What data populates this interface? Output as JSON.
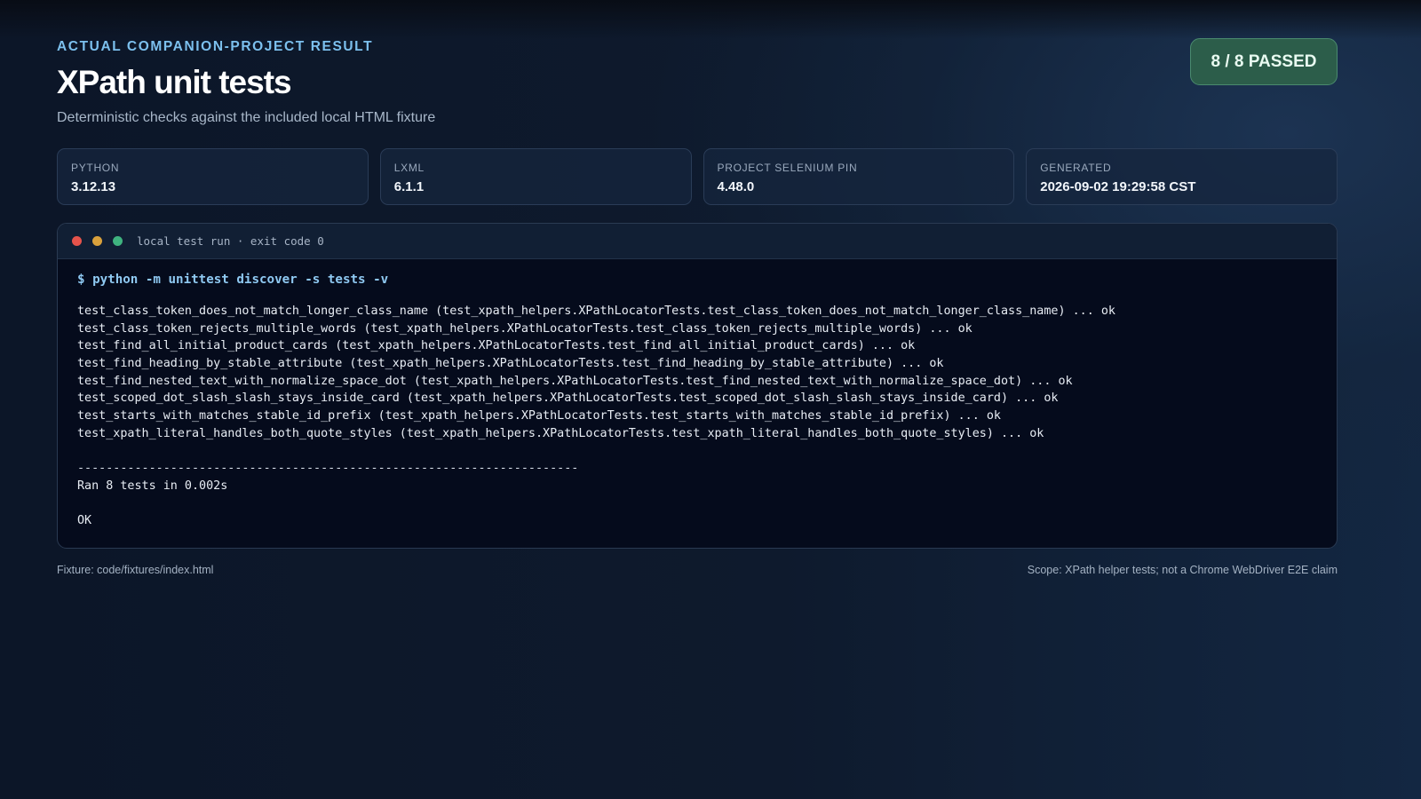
{
  "header": {
    "eyebrow": "ACTUAL COMPANION-PROJECT RESULT",
    "title": "XPath unit tests",
    "subtitle": "Deterministic checks against the included local HTML fixture",
    "status_badge": "8 / 8 PASSED",
    "status_color": "#2c5d4a"
  },
  "info_cards": [
    {
      "label": "PYTHON",
      "value": "3.12.13"
    },
    {
      "label": "LXML",
      "value": "6.1.1"
    },
    {
      "label": "PROJECT SELENIUM PIN",
      "value": "4.48.0"
    },
    {
      "label": "GENERATED",
      "value": "2026-09-02 19:29:58 CST"
    }
  ],
  "terminal": {
    "title": "local test run · exit code 0",
    "command": "$ python -m unittest discover -s tests -v",
    "lines": [
      "test_class_token_does_not_match_longer_class_name (test_xpath_helpers.XPathLocatorTests.test_class_token_does_not_match_longer_class_name) ... ok",
      "test_class_token_rejects_multiple_words (test_xpath_helpers.XPathLocatorTests.test_class_token_rejects_multiple_words) ... ok",
      "test_find_all_initial_product_cards (test_xpath_helpers.XPathLocatorTests.test_find_all_initial_product_cards) ... ok",
      "test_find_heading_by_stable_attribute (test_xpath_helpers.XPathLocatorTests.test_find_heading_by_stable_attribute) ... ok",
      "test_find_nested_text_with_normalize_space_dot (test_xpath_helpers.XPathLocatorTests.test_find_nested_text_with_normalize_space_dot) ... ok",
      "test_scoped_dot_slash_slash_stays_inside_card (test_xpath_helpers.XPathLocatorTests.test_scoped_dot_slash_slash_stays_inside_card) ... ok",
      "test_starts_with_matches_stable_id_prefix (test_xpath_helpers.XPathLocatorTests.test_starts_with_matches_stable_id_prefix) ... ok",
      "test_xpath_literal_handles_both_quote_styles (test_xpath_helpers.XPathLocatorTests.test_xpath_literal_handles_both_quote_styles) ... ok"
    ],
    "separator": "----------------------------------------------------------------------",
    "summary": "Ran 8 tests in 0.002s",
    "result": "OK"
  },
  "footer": {
    "fixture": "Fixture: code/fixtures/index.html",
    "scope": "Scope: XPath helper tests; not a Chrome WebDriver E2E claim"
  }
}
